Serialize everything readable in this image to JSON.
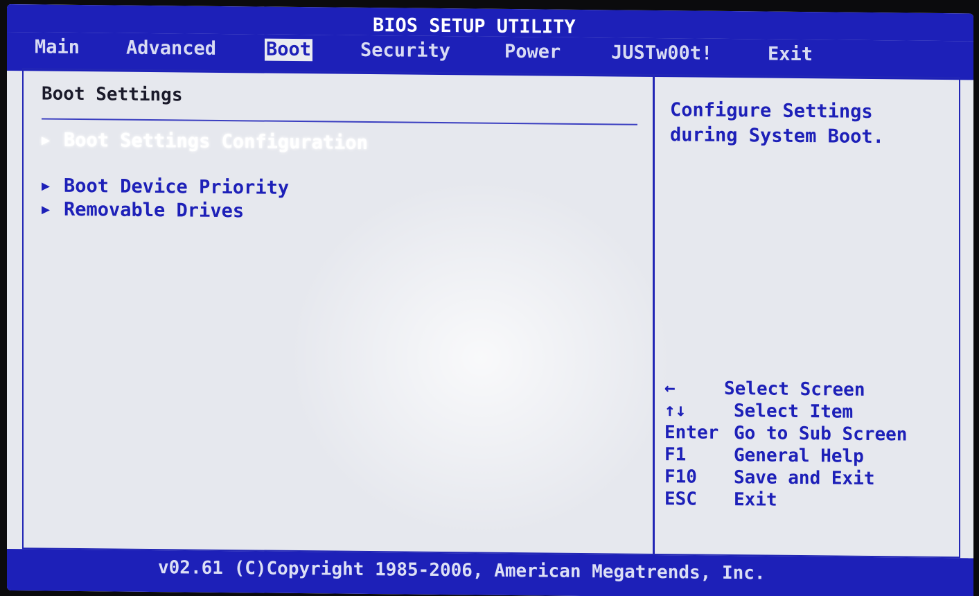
{
  "app": {
    "title": "BIOS SETUP UTILITY"
  },
  "tabs": [
    {
      "label": "Main",
      "active": false
    },
    {
      "label": "Advanced",
      "active": false
    },
    {
      "label": "Boot",
      "active": true
    },
    {
      "label": "Security",
      "active": false
    },
    {
      "label": "Power",
      "active": false
    },
    {
      "label": "JUSTw00t!",
      "active": false
    },
    {
      "label": "Exit",
      "active": false
    }
  ],
  "main": {
    "heading": "Boot Settings",
    "items": [
      {
        "label": "Boot Settings Configuration",
        "selected": true
      },
      {
        "label": "Boot Device Priority",
        "selected": false
      },
      {
        "label": "Removable Drives",
        "selected": false
      }
    ]
  },
  "help": {
    "text": "Configure Settings during System Boot."
  },
  "keys": [
    {
      "key": "←",
      "desc": "Select Screen"
    },
    {
      "key": "↑↓",
      "desc": "Select Item"
    },
    {
      "key": "Enter",
      "desc": "Go to Sub Screen"
    },
    {
      "key": "F1",
      "desc": "General Help"
    },
    {
      "key": "F10",
      "desc": "Save and Exit"
    },
    {
      "key": "ESC",
      "desc": "Exit"
    }
  ],
  "footer": {
    "copyright": "v02.61 (C)Copyright 1985-2006, American Megatrends, Inc."
  },
  "colors": {
    "bios_blue": "#1d20b8",
    "background": "#e6e8ee",
    "highlight_text": "#ffffff"
  },
  "icons": {
    "submenu_arrow": "right-triangle-icon"
  }
}
